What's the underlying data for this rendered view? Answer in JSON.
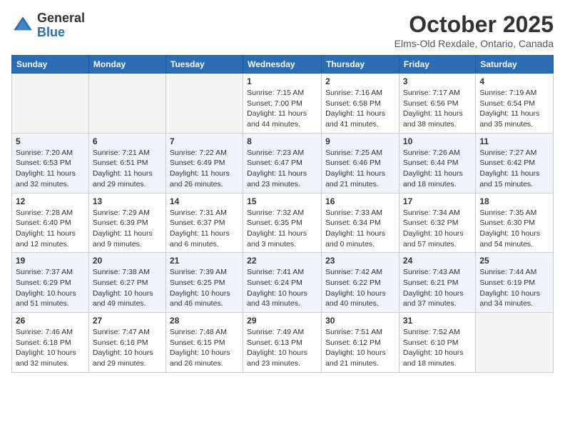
{
  "header": {
    "logo_general": "General",
    "logo_blue": "Blue",
    "month_title": "October 2025",
    "location": "Elms-Old Rexdale, Ontario, Canada"
  },
  "weekdays": [
    "Sunday",
    "Monday",
    "Tuesday",
    "Wednesday",
    "Thursday",
    "Friday",
    "Saturday"
  ],
  "weeks": [
    [
      {
        "day": "",
        "info": ""
      },
      {
        "day": "",
        "info": ""
      },
      {
        "day": "",
        "info": ""
      },
      {
        "day": "1",
        "info": "Sunrise: 7:15 AM\nSunset: 7:00 PM\nDaylight: 11 hours\nand 44 minutes."
      },
      {
        "day": "2",
        "info": "Sunrise: 7:16 AM\nSunset: 6:58 PM\nDaylight: 11 hours\nand 41 minutes."
      },
      {
        "day": "3",
        "info": "Sunrise: 7:17 AM\nSunset: 6:56 PM\nDaylight: 11 hours\nand 38 minutes."
      },
      {
        "day": "4",
        "info": "Sunrise: 7:19 AM\nSunset: 6:54 PM\nDaylight: 11 hours\nand 35 minutes."
      }
    ],
    [
      {
        "day": "5",
        "info": "Sunrise: 7:20 AM\nSunset: 6:53 PM\nDaylight: 11 hours\nand 32 minutes."
      },
      {
        "day": "6",
        "info": "Sunrise: 7:21 AM\nSunset: 6:51 PM\nDaylight: 11 hours\nand 29 minutes."
      },
      {
        "day": "7",
        "info": "Sunrise: 7:22 AM\nSunset: 6:49 PM\nDaylight: 11 hours\nand 26 minutes."
      },
      {
        "day": "8",
        "info": "Sunrise: 7:23 AM\nSunset: 6:47 PM\nDaylight: 11 hours\nand 23 minutes."
      },
      {
        "day": "9",
        "info": "Sunrise: 7:25 AM\nSunset: 6:46 PM\nDaylight: 11 hours\nand 21 minutes."
      },
      {
        "day": "10",
        "info": "Sunrise: 7:26 AM\nSunset: 6:44 PM\nDaylight: 11 hours\nand 18 minutes."
      },
      {
        "day": "11",
        "info": "Sunrise: 7:27 AM\nSunset: 6:42 PM\nDaylight: 11 hours\nand 15 minutes."
      }
    ],
    [
      {
        "day": "12",
        "info": "Sunrise: 7:28 AM\nSunset: 6:40 PM\nDaylight: 11 hours\nand 12 minutes."
      },
      {
        "day": "13",
        "info": "Sunrise: 7:29 AM\nSunset: 6:39 PM\nDaylight: 11 hours\nand 9 minutes."
      },
      {
        "day": "14",
        "info": "Sunrise: 7:31 AM\nSunset: 6:37 PM\nDaylight: 11 hours\nand 6 minutes."
      },
      {
        "day": "15",
        "info": "Sunrise: 7:32 AM\nSunset: 6:35 PM\nDaylight: 11 hours\nand 3 minutes."
      },
      {
        "day": "16",
        "info": "Sunrise: 7:33 AM\nSunset: 6:34 PM\nDaylight: 11 hours\nand 0 minutes."
      },
      {
        "day": "17",
        "info": "Sunrise: 7:34 AM\nSunset: 6:32 PM\nDaylight: 10 hours\nand 57 minutes."
      },
      {
        "day": "18",
        "info": "Sunrise: 7:35 AM\nSunset: 6:30 PM\nDaylight: 10 hours\nand 54 minutes."
      }
    ],
    [
      {
        "day": "19",
        "info": "Sunrise: 7:37 AM\nSunset: 6:29 PM\nDaylight: 10 hours\nand 51 minutes."
      },
      {
        "day": "20",
        "info": "Sunrise: 7:38 AM\nSunset: 6:27 PM\nDaylight: 10 hours\nand 49 minutes."
      },
      {
        "day": "21",
        "info": "Sunrise: 7:39 AM\nSunset: 6:25 PM\nDaylight: 10 hours\nand 46 minutes."
      },
      {
        "day": "22",
        "info": "Sunrise: 7:41 AM\nSunset: 6:24 PM\nDaylight: 10 hours\nand 43 minutes."
      },
      {
        "day": "23",
        "info": "Sunrise: 7:42 AM\nSunset: 6:22 PM\nDaylight: 10 hours\nand 40 minutes."
      },
      {
        "day": "24",
        "info": "Sunrise: 7:43 AM\nSunset: 6:21 PM\nDaylight: 10 hours\nand 37 minutes."
      },
      {
        "day": "25",
        "info": "Sunrise: 7:44 AM\nSunset: 6:19 PM\nDaylight: 10 hours\nand 34 minutes."
      }
    ],
    [
      {
        "day": "26",
        "info": "Sunrise: 7:46 AM\nSunset: 6:18 PM\nDaylight: 10 hours\nand 32 minutes."
      },
      {
        "day": "27",
        "info": "Sunrise: 7:47 AM\nSunset: 6:16 PM\nDaylight: 10 hours\nand 29 minutes."
      },
      {
        "day": "28",
        "info": "Sunrise: 7:48 AM\nSunset: 6:15 PM\nDaylight: 10 hours\nand 26 minutes."
      },
      {
        "day": "29",
        "info": "Sunrise: 7:49 AM\nSunset: 6:13 PM\nDaylight: 10 hours\nand 23 minutes."
      },
      {
        "day": "30",
        "info": "Sunrise: 7:51 AM\nSunset: 6:12 PM\nDaylight: 10 hours\nand 21 minutes."
      },
      {
        "day": "31",
        "info": "Sunrise: 7:52 AM\nSunset: 6:10 PM\nDaylight: 10 hours\nand 18 minutes."
      },
      {
        "day": "",
        "info": ""
      }
    ]
  ],
  "shaded_rows": [
    1,
    3
  ]
}
